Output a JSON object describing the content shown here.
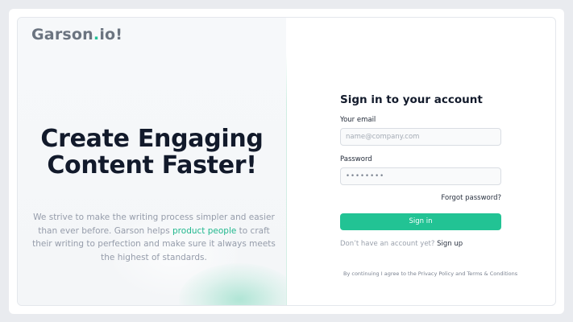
{
  "brand": {
    "name_main": "Garson",
    "name_dot": ".",
    "name_tail": "io!"
  },
  "hero": {
    "line1": "Create Engaging",
    "line2": "Content Faster!"
  },
  "description": {
    "before": "We strive to make the writing process simpler and easier than ever before. Garson helps ",
    "highlight": "product people",
    "after": " to craft their writing to perfection and make sure it always meets the highest of standards."
  },
  "form": {
    "title": "Sign in to your account",
    "email_label": "Your email",
    "email_placeholder": "name@company.com",
    "email_value": "",
    "password_label": "Password",
    "password_value": "••••••••",
    "forgot_label": "Forgot password?",
    "submit_label": "Sign in",
    "no_account_text": "Don’t have an account yet? ",
    "signup_label": "Sign up",
    "terms_text": "By continuing I agree to the Privacy Policy and Terms & Conditions"
  },
  "colors": {
    "accent": "#22c394",
    "background": "#e9ebef",
    "left_panel": "#f5f7f9"
  }
}
